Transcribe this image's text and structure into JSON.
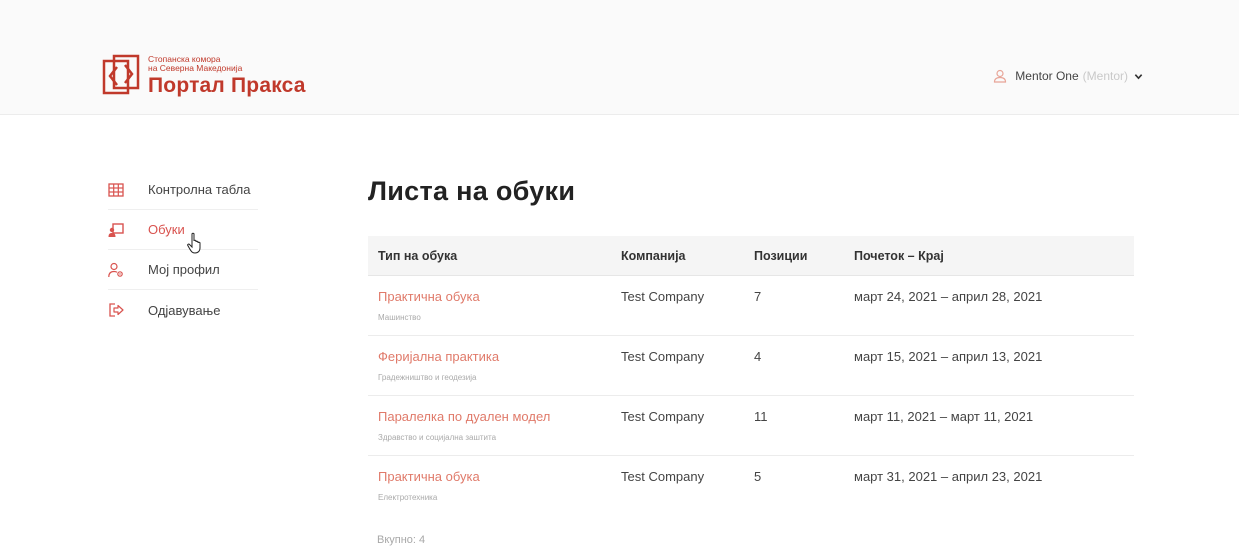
{
  "header": {
    "logo_line1": "Стопанска комора",
    "logo_line2": "на Северна Македонија",
    "logo_title": "Портал Пракса",
    "user_name": "Mentor One",
    "user_role": "(Mentor)"
  },
  "sidebar": {
    "items": [
      {
        "label": "Контролна табла",
        "icon": "dashboard-grid-icon"
      },
      {
        "label": "Обуки",
        "icon": "training-icon"
      },
      {
        "label": "Мој профил",
        "icon": "profile-settings-icon"
      },
      {
        "label": "Одјавување",
        "icon": "logout-icon"
      }
    ]
  },
  "main": {
    "title": "Листа на обуки",
    "columns": [
      "Тип на обука",
      "Компанија",
      "Позиции",
      "Почеток – Крај"
    ],
    "rows": [
      {
        "type": "Практична обука",
        "sector": "Машинство",
        "company": "Test Company",
        "positions": "7",
        "dates": "март 24, 2021 – април 28, 2021"
      },
      {
        "type": "Феријална практика",
        "sector": "Градежништво и геодезија",
        "company": "Test Company",
        "positions": "4",
        "dates": "март 15, 2021 – април 13, 2021"
      },
      {
        "type": "Паралелка по дуален модел",
        "sector": "Здравство и социјална заштита",
        "company": "Test Company",
        "positions": "11",
        "dates": "март 11, 2021 – март 11, 2021"
      },
      {
        "type": "Практична обука",
        "sector": "Електротехника",
        "company": "Test Company",
        "positions": "5",
        "dates": "март 31, 2021 – април 23, 2021"
      }
    ],
    "total": "Вкупно: 4"
  },
  "colors": {
    "accent": "#d9534f",
    "link": "#e07a6a",
    "brand": "#c0392b"
  }
}
